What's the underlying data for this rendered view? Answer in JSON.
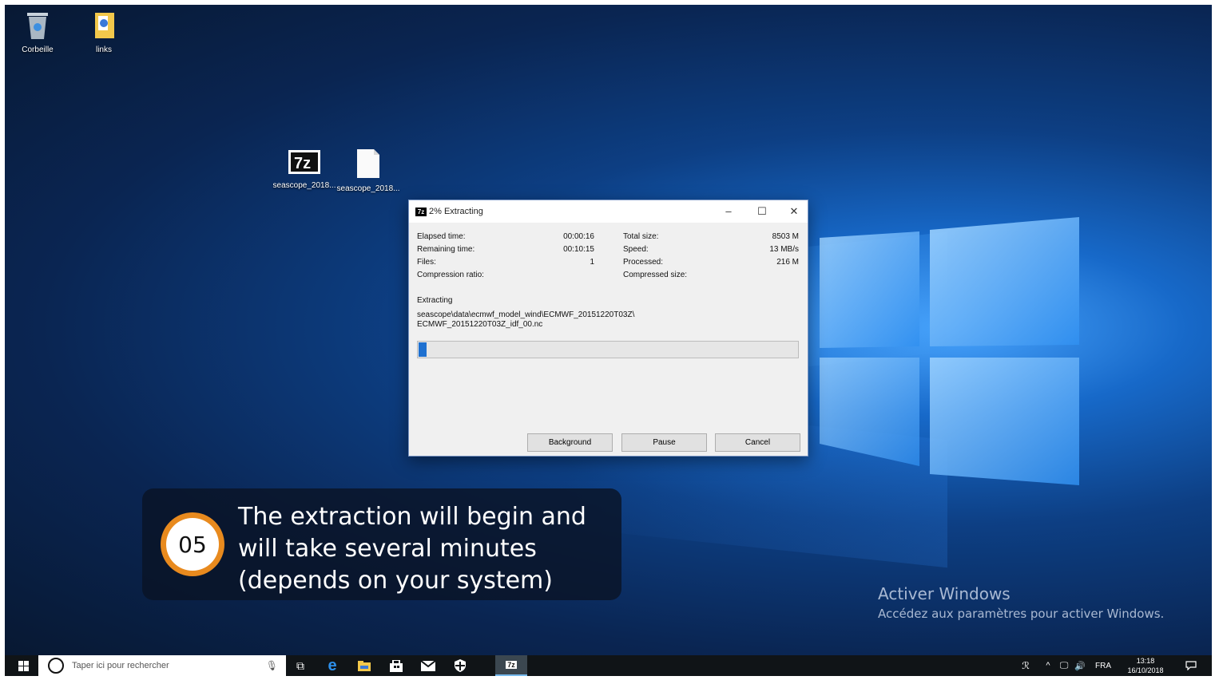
{
  "desktop": {
    "icons": [
      {
        "label": "Corbeille",
        "icon": "recycle-bin-icon"
      },
      {
        "label": "links",
        "icon": "folder-icon"
      },
      {
        "label": "seascope_2018...",
        "icon": "7zip-archive-icon"
      },
      {
        "label": "seascope_2018...",
        "icon": "blank-file-icon"
      }
    ]
  },
  "dialog": {
    "title_icon": "7z",
    "title": "2% Extracting",
    "left_stats": [
      {
        "label": "Elapsed time:",
        "value": "00:00:16"
      },
      {
        "label": "Remaining time:",
        "value": "00:10:15"
      },
      {
        "label": "Files:",
        "value": "1"
      },
      {
        "label": "Compression ratio:",
        "value": ""
      }
    ],
    "right_stats": [
      {
        "label": "Total size:",
        "value": "8503 M"
      },
      {
        "label": "Speed:",
        "value": "13 MB/s"
      },
      {
        "label": "Processed:",
        "value": "216 M"
      },
      {
        "label": "Compressed size:",
        "value": ""
      }
    ],
    "action_label": "Extracting",
    "current_path_line1": "seascope\\data\\ecmwf_model_wind\\ECMWF_20151220T03Z\\",
    "current_path_line2": "ECMWF_20151220T03Z_idf_00.nc",
    "progress_fraction": 0.02,
    "buttons": {
      "background": "Background",
      "pause": "Pause",
      "cancel": "Cancel"
    }
  },
  "callout": {
    "step": "05",
    "text": "The extraction will begin and\nwill take several minutes\n(depends on your system)",
    "accent_color": "#e88a1e"
  },
  "activation": {
    "heading": "Activer Windows",
    "subtext": "Accédez aux paramètres pour activer Windows."
  },
  "taskbar": {
    "search_placeholder": "Taper ici pour rechercher",
    "language": "FRA",
    "time": "13:18",
    "date": "16/10/2018",
    "pinned": [
      "task-view-icon",
      "edge-icon",
      "file-explorer-icon",
      "store-icon",
      "mail-icon",
      "defender-icon",
      "7zip-icon"
    ]
  }
}
